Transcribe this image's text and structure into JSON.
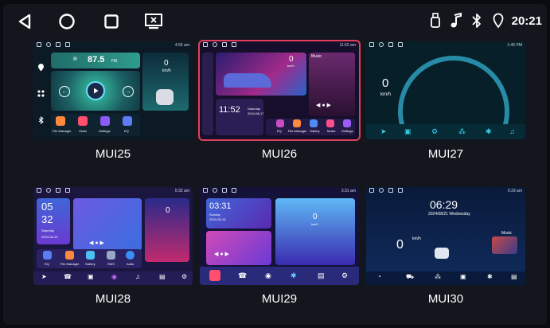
{
  "status_bar": {
    "time": "20:21",
    "icons": [
      "back-icon",
      "home-icon",
      "recents-icon",
      "screen-off-icon",
      "usb-icon",
      "music-note-icon",
      "bluetooth-icon",
      "location-icon"
    ]
  },
  "themes": [
    {
      "label": "MUI25",
      "mini_time": "4:55 am",
      "frequency": "87.5",
      "band": "FM",
      "speed": "0",
      "speed_unit": "km/h",
      "apps": [
        "File Manager",
        "Video",
        "Settings",
        "EQ"
      ]
    },
    {
      "label": "MUI26",
      "mini_time": "11:52 am",
      "speed": "0",
      "speed_unit": "km/h",
      "music_label": "Music",
      "clock": "11:52",
      "day": "Saturday",
      "date": "2024-08-17",
      "apps": [
        "EQ",
        "File Manager",
        "Gallery",
        "Music",
        "Settings"
      ]
    },
    {
      "label": "MUI27",
      "mini_time": "1:45 PM",
      "speed": "0",
      "speed_unit": "km/h"
    },
    {
      "label": "MUI28",
      "mini_time": "5:32 am",
      "clock_hour": "05",
      "clock_min": "32",
      "day": "Saturday",
      "date": "2024-08-10",
      "speed": "0",
      "apps": [
        "EQ",
        "File Manager",
        "Gallery",
        "SWC",
        "Adds"
      ]
    },
    {
      "label": "MUI29",
      "mini_time": "3:31 am",
      "clock": "03:31",
      "day": "Sunday",
      "date": "2024-08-18",
      "speed": "0",
      "speed_unit": "km/h"
    },
    {
      "label": "MUI30",
      "mini_time": "6:29 am",
      "clock": "06:29",
      "date": "2024/08/21 Wednesday",
      "speed": "0",
      "speed_unit": "km/h",
      "music_label": "Music"
    }
  ],
  "colors": {
    "background": "#13161d",
    "selected_border": "#e0405c"
  }
}
